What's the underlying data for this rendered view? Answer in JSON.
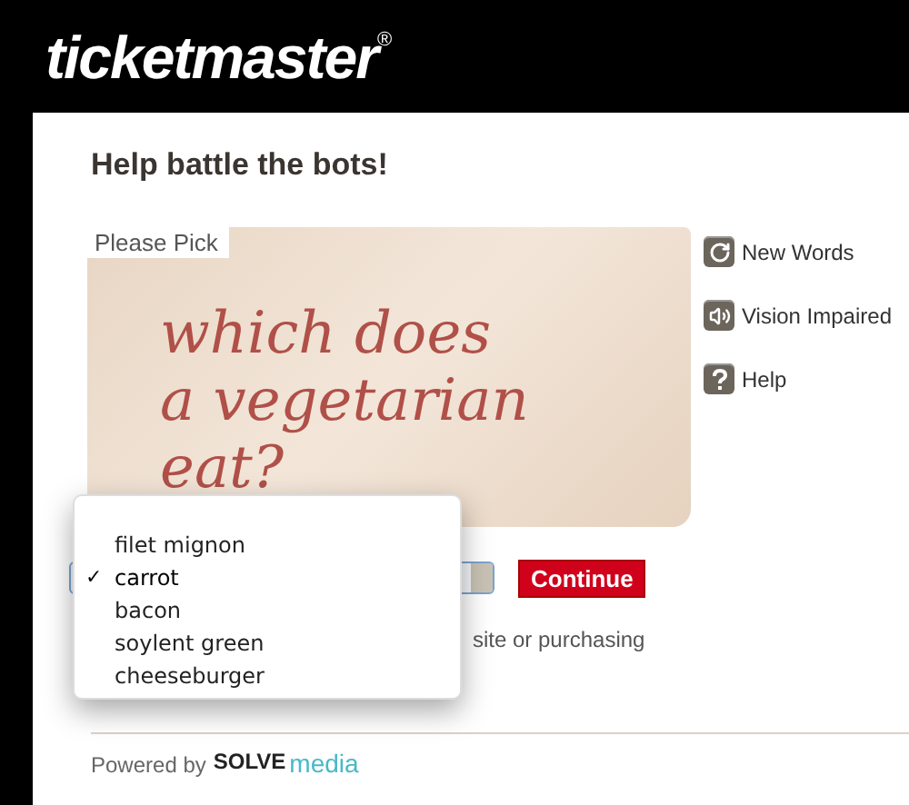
{
  "logo": {
    "text": "ticketmaster",
    "mark": "®"
  },
  "heading": "Help battle the bots!",
  "captcha": {
    "label": "Please Pick",
    "question_lines": [
      "which does",
      "a vegetarian",
      "eat?"
    ]
  },
  "side_links": [
    {
      "kind": "refresh",
      "label": "New Words"
    },
    {
      "kind": "audio",
      "label": "Vision Impaired"
    },
    {
      "kind": "help",
      "label": "Help"
    }
  ],
  "dropdown": {
    "options": [
      {
        "label": "filet mignon",
        "selected": false
      },
      {
        "label": "carrot",
        "selected": true
      },
      {
        "label": "bacon",
        "selected": false
      },
      {
        "label": "soylent green",
        "selected": false
      },
      {
        "label": "cheeseburger",
        "selected": false
      }
    ],
    "check": "✓"
  },
  "continue_button": "Continue",
  "notice": "site or purchasing",
  "footer": {
    "powered_by": "Powered by",
    "brand_bold": "SOLVE",
    "brand_light": "media"
  }
}
